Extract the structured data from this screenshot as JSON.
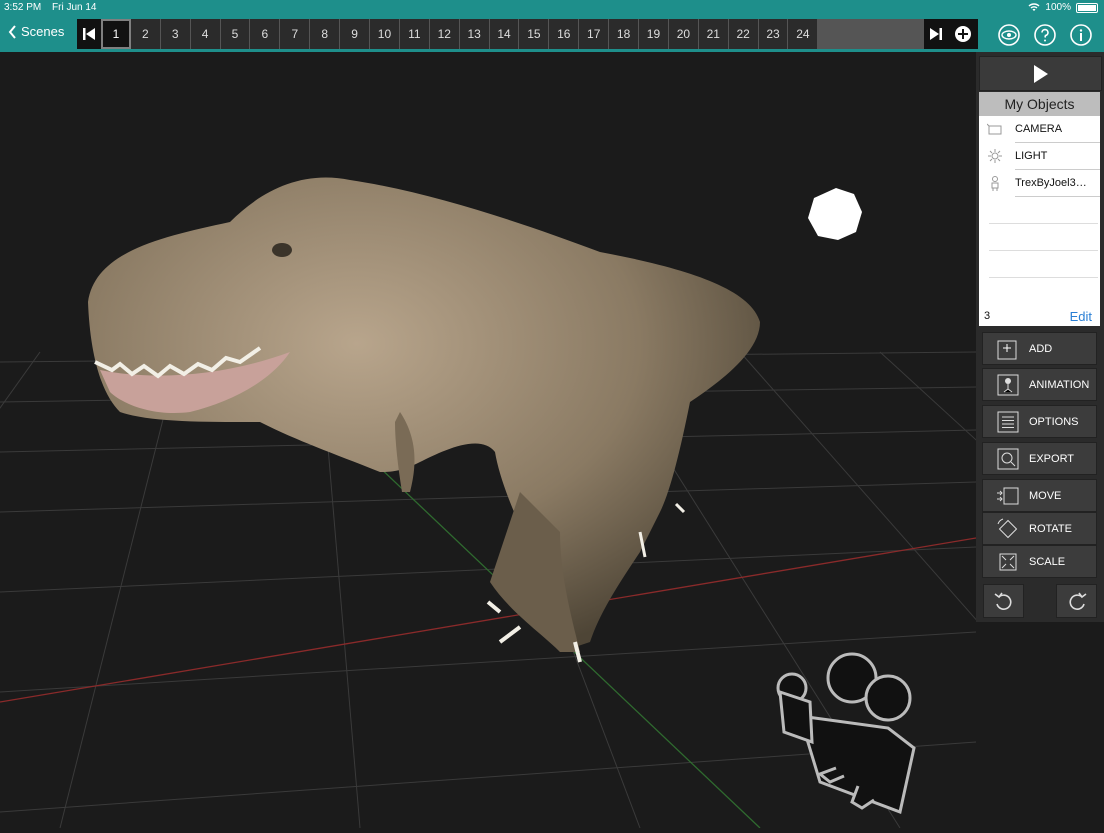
{
  "status": {
    "time": "3:52 PM",
    "date": "Fri Jun 14",
    "battery": "100%"
  },
  "nav": {
    "back_label": "Scenes"
  },
  "timeline": {
    "frames": [
      "1",
      "2",
      "3",
      "4",
      "5",
      "6",
      "7",
      "8",
      "9",
      "10",
      "11",
      "12",
      "13",
      "14",
      "15",
      "16",
      "17",
      "18",
      "19",
      "20",
      "21",
      "22",
      "23",
      "24"
    ],
    "selected": "1"
  },
  "objects": {
    "title": "My Objects",
    "items": [
      {
        "label": "CAMERA",
        "icon": "camera-icon"
      },
      {
        "label": "LIGHT",
        "icon": "light-icon"
      },
      {
        "label": "TrexByJoel3…",
        "icon": "model-icon"
      }
    ],
    "count": "3",
    "edit_label": "Edit"
  },
  "tools": [
    {
      "label": "ADD",
      "icon": "add-icon"
    },
    {
      "label": "ANIMATION",
      "icon": "animation-icon"
    },
    {
      "label": "OPTIONS",
      "icon": "options-icon"
    },
    {
      "label": "EXPORT",
      "icon": "export-icon"
    },
    {
      "label": "MOVE",
      "icon": "move-icon"
    },
    {
      "label": "ROTATE",
      "icon": "rotate-icon"
    },
    {
      "label": "SCALE",
      "icon": "scale-icon"
    }
  ],
  "colors": {
    "accent": "#1e8f8b",
    "panel": "#2b2b2b",
    "viewport": "#1b1b1b",
    "link": "#2a7fd4"
  }
}
